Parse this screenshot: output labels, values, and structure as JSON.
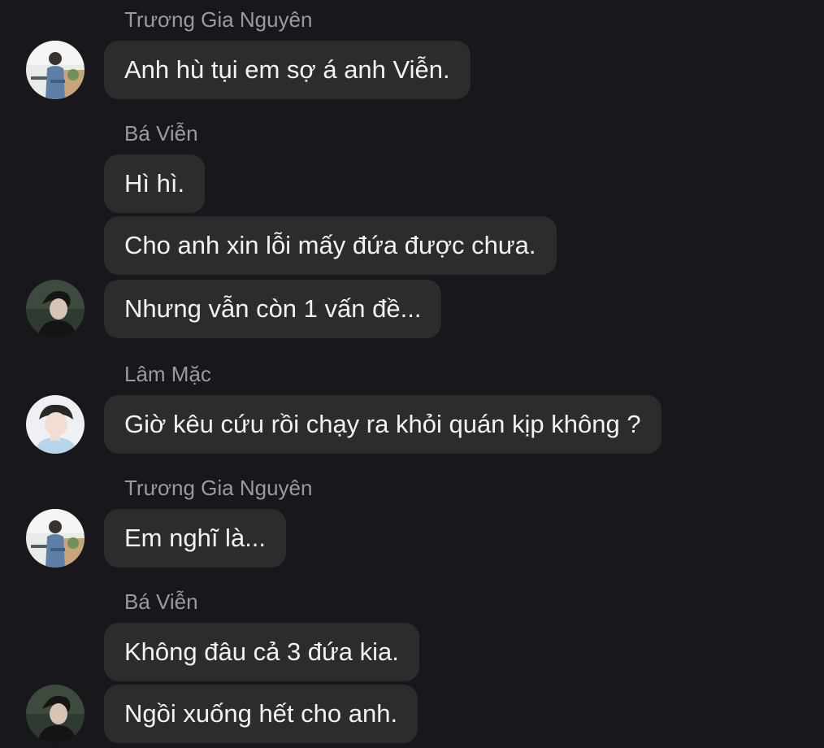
{
  "conversation": {
    "groups": [
      {
        "sender": "Trương Gia Nguyên",
        "avatar": "avatar-nguyen-icon",
        "messages": [
          "Anh hù tụi em sợ á anh Viễn."
        ]
      },
      {
        "sender": "Bá Viễn",
        "avatar": "avatar-vien-icon",
        "messages": [
          "Hì hì.",
          "Cho anh xin lỗi mấy đứa được chưa.",
          "Nhưng vẫn còn 1 vấn đề..."
        ]
      },
      {
        "sender": "Lâm Mặc",
        "avatar": "avatar-lam-mac-icon",
        "messages": [
          "Giờ kêu cứu rồi chạy ra khỏi quán kịp không ?"
        ]
      },
      {
        "sender": "Trương Gia Nguyên",
        "avatar": "avatar-nguyen-icon",
        "messages": [
          "Em nghĩ là..."
        ]
      },
      {
        "sender": "Bá Viễn",
        "avatar": "avatar-vien-icon",
        "messages": [
          "Không đâu cả 3 đứa kia.",
          "Ngồi xuống hết cho anh."
        ]
      }
    ]
  },
  "colors": {
    "background": "#18171c",
    "bubble": "#2c2c2f",
    "message_text": "#f2f2f4",
    "sender_text": "#9a9aa0"
  }
}
